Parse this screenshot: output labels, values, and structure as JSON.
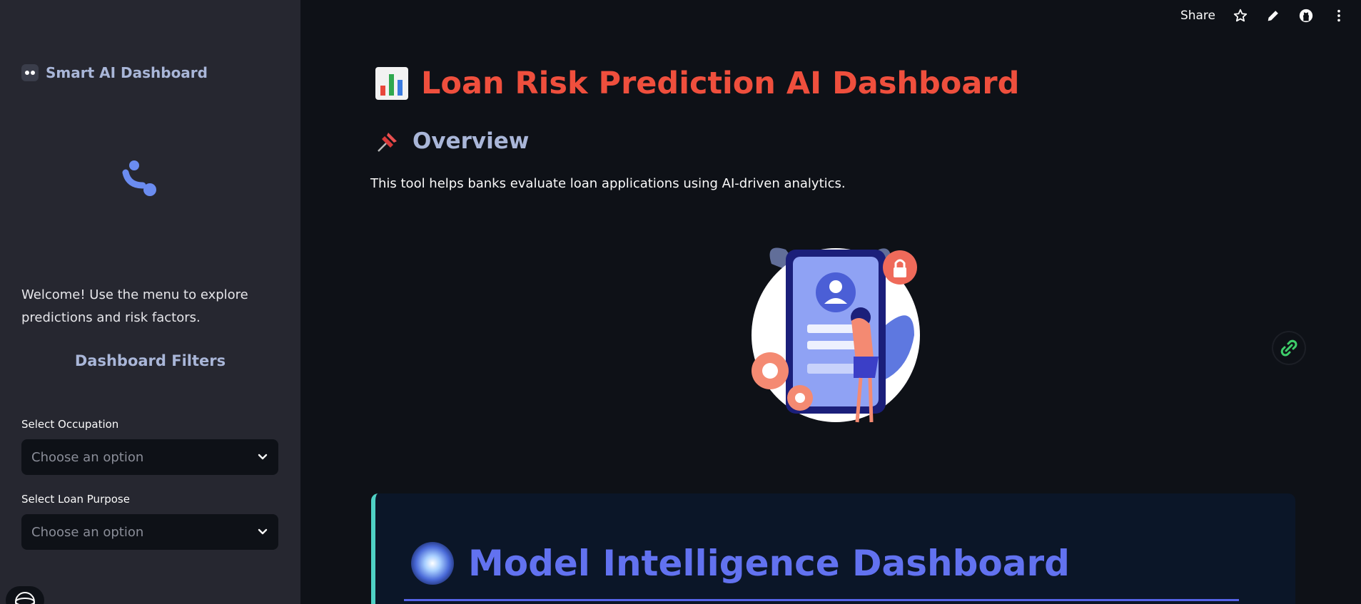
{
  "sidebar": {
    "brand_title": "Smart AI Dashboard",
    "welcome_text": "Welcome! Use the menu to explore predictions and risk factors.",
    "filters_title": "Dashboard Filters",
    "filters": [
      {
        "label": "Select Occupation",
        "placeholder": "Choose an option"
      },
      {
        "label": "Select Loan Purpose",
        "placeholder": "Choose an option"
      }
    ]
  },
  "topbar": {
    "share_label": "Share",
    "icons": [
      "star-icon",
      "pencil-icon",
      "github-icon",
      "more-vertical-icon"
    ]
  },
  "main": {
    "title": "Loan Risk Prediction AI Dashboard",
    "overview_heading": "Overview",
    "intro_text": "This tool helps banks evaluate loan applications using AI-driven analytics.",
    "card_title": "Model Intelligence Dashboard"
  },
  "colors": {
    "background": "#0e1117",
    "sidebar": "#262730",
    "title_red": "#ef4f3d",
    "heading_blue": "#a9b6d8",
    "card_title": "#6272f0",
    "card_accent": "#4fd1c5"
  }
}
